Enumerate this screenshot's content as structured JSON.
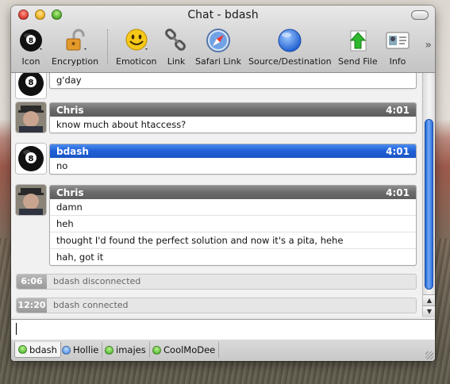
{
  "window": {
    "title": "Chat - bdash"
  },
  "toolbar": {
    "items": [
      {
        "label": "Icon",
        "icon": "8-ball-icon"
      },
      {
        "label": "Encryption",
        "icon": "padlock-icon"
      },
      {
        "label": "Emoticon",
        "icon": "smiley-icon"
      },
      {
        "label": "Link",
        "icon": "chain-link-icon"
      },
      {
        "label": "Safari Link",
        "icon": "compass-icon"
      },
      {
        "label": "Source/Destination",
        "icon": "blue-globe-icon"
      },
      {
        "label": "Send File",
        "icon": "send-file-icon"
      },
      {
        "label": "Info",
        "icon": "info-card-icon"
      }
    ],
    "overflow": "»"
  },
  "messages": [
    {
      "sender": "",
      "lines": [
        "g'day"
      ]
    },
    {
      "sender": "Chris",
      "time": "4:01",
      "lines": [
        "know much about htaccess?"
      ]
    },
    {
      "sender": "bdash",
      "time": "4:01",
      "lines": [
        "no"
      ]
    },
    {
      "sender": "Chris",
      "time": "4:01",
      "lines": [
        "damn",
        "heh",
        "thought I'd found the perfect solution and now it's a pita, hehe",
        "hah, got it"
      ]
    }
  ],
  "status_events": [
    {
      "time": "6:06",
      "text": "bdash disconnected"
    },
    {
      "time": "12:20",
      "text": "bdash connected"
    }
  ],
  "input": {
    "value": ""
  },
  "tabs": [
    {
      "label": "bdash",
      "status": "green",
      "active": true
    },
    {
      "label": "Hollie",
      "status": "blue",
      "active": false
    },
    {
      "label": "imajes",
      "status": "green",
      "active": false
    },
    {
      "label": "CoolMoDee",
      "status": "green",
      "active": false
    }
  ],
  "colors": {
    "accent_blue": "#1f5fd6",
    "header_gray": "#6b6b6b",
    "online_green": "#3aa81c",
    "away_blue": "#3a7fe0"
  }
}
